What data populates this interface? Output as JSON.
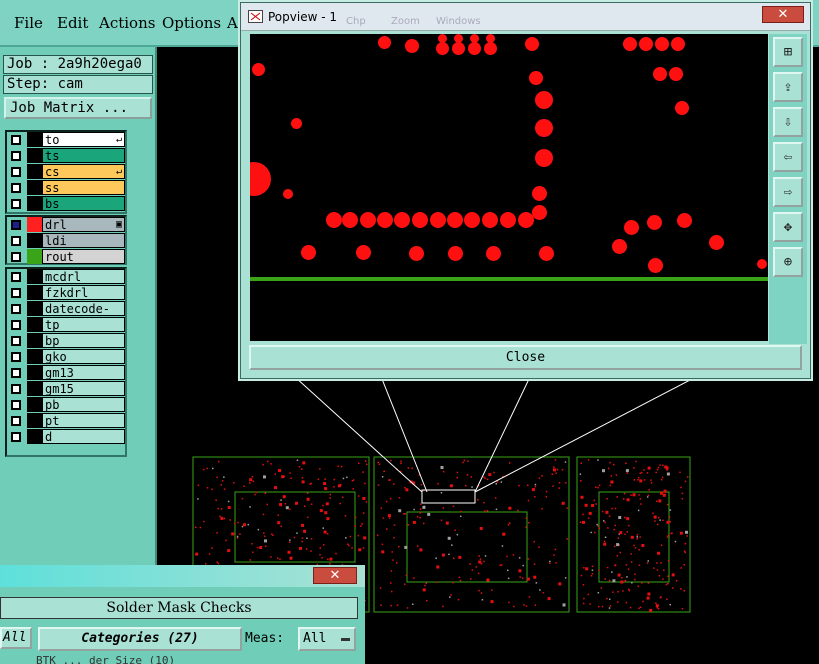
{
  "menubar": {
    "items": [
      "File",
      "Edit",
      "Actions",
      "Options",
      "A"
    ]
  },
  "job": {
    "job_line": "Job : 2a9h20ega0",
    "step_line": "Step: cam",
    "matrix_button": "Job Matrix ..."
  },
  "layers": {
    "group1": [
      {
        "name": "to",
        "color": "#ffffff",
        "mark": "↵"
      },
      {
        "name": "ts",
        "color": "#1aa57a",
        "mark": ""
      },
      {
        "name": "cs",
        "color": "#ffc85a",
        "mark": "↵"
      },
      {
        "name": "ss",
        "color": "#ffc85a",
        "mark": ""
      },
      {
        "name": "bs",
        "color": "#1aa57a",
        "mark": ""
      }
    ],
    "group2": [
      {
        "name": "drl",
        "color": "#a8b8bc",
        "mark": "▣",
        "swatch": "#ff2020"
      },
      {
        "name": "ldi",
        "color": "#a8b8bc",
        "mark": ""
      },
      {
        "name": "rout",
        "color": "#d3d3d3",
        "mark": "",
        "swatch": "#3aa418"
      }
    ],
    "group3": [
      "mcdrl",
      "fzkdrl",
      "datecode-to",
      "tp",
      "bp",
      "gko",
      "gm13",
      "gm15",
      "pb",
      "pt",
      "d"
    ]
  },
  "popview": {
    "title": "Popview - 1",
    "close_label": "Close",
    "close_x": "✕",
    "behind_menu": [
      "Chp",
      "Zoom",
      "Windows"
    ],
    "toolbar_icons": [
      "zoom-fit-icon",
      "zoom-home-icon",
      "zoom-in-icon",
      "pan-left-icon",
      "pan-right-icon",
      "zoom-expand-icon",
      "zoom-center-icon"
    ]
  },
  "solder": {
    "title": "Solder Mask Checks",
    "all_label": "All",
    "categories_label": "Categories (27)",
    "meas_label": "Meas:",
    "meas_value": "All",
    "row_partial": "BTK ... der Size (10)"
  },
  "colors": {
    "accent": "#7ed3c3",
    "pad": "#ff1010",
    "trace": "#3aa418"
  }
}
